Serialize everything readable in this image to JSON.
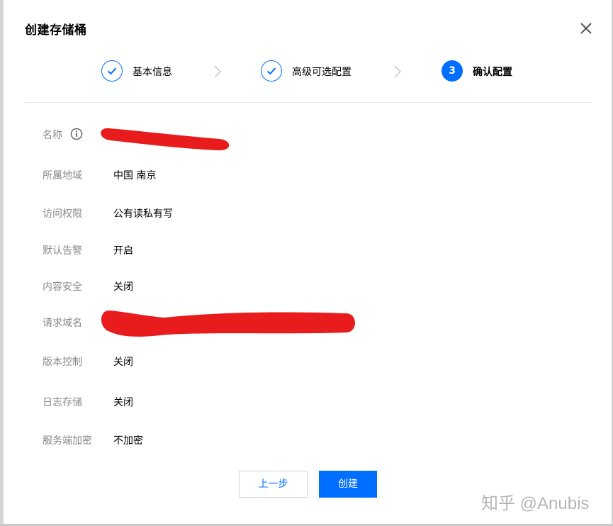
{
  "dialog": {
    "title": "创建存储桶"
  },
  "steps": [
    {
      "label": "基本信息",
      "status": "done"
    },
    {
      "label": "高级可选配置",
      "status": "done"
    },
    {
      "number": "3",
      "label": "确认配置",
      "status": "active"
    }
  ],
  "fields": {
    "name": {
      "label": "名称"
    },
    "region": {
      "label": "所属地域",
      "value": "中国 南京"
    },
    "access": {
      "label": "访问权限",
      "value": "公有读私有写"
    },
    "alarm": {
      "label": "默认告警",
      "value": "开启"
    },
    "content_security": {
      "label": "内容安全",
      "value": "关闭"
    },
    "domain": {
      "label": "请求域名"
    },
    "versioning": {
      "label": "版本控制",
      "value": "关闭"
    },
    "logging": {
      "label": "日志存储",
      "value": "关闭"
    },
    "encryption": {
      "label": "服务端加密",
      "value": "不加密"
    }
  },
  "buttons": {
    "prev": "上一步",
    "create": "创建"
  },
  "watermark": "知乎 @Anubis",
  "colors": {
    "primary": "#006eff",
    "redaction": "#e81c1c",
    "label": "#888888"
  },
  "icons": {
    "close": "close-icon",
    "step_done": "checkmark-icon",
    "step_separator": "chevron-right-icon",
    "name_info": "info-icon"
  }
}
